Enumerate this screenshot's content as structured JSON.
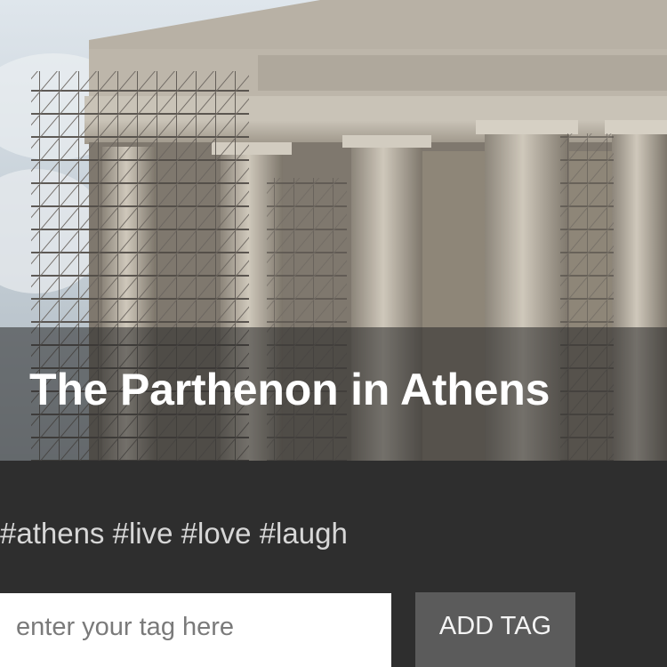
{
  "hero": {
    "title": "The Parthenon in Athens"
  },
  "tags": {
    "text": "#athens #live #love #laugh"
  },
  "form": {
    "placeholder": "enter your tag here",
    "button_label": "ADD TAG"
  }
}
